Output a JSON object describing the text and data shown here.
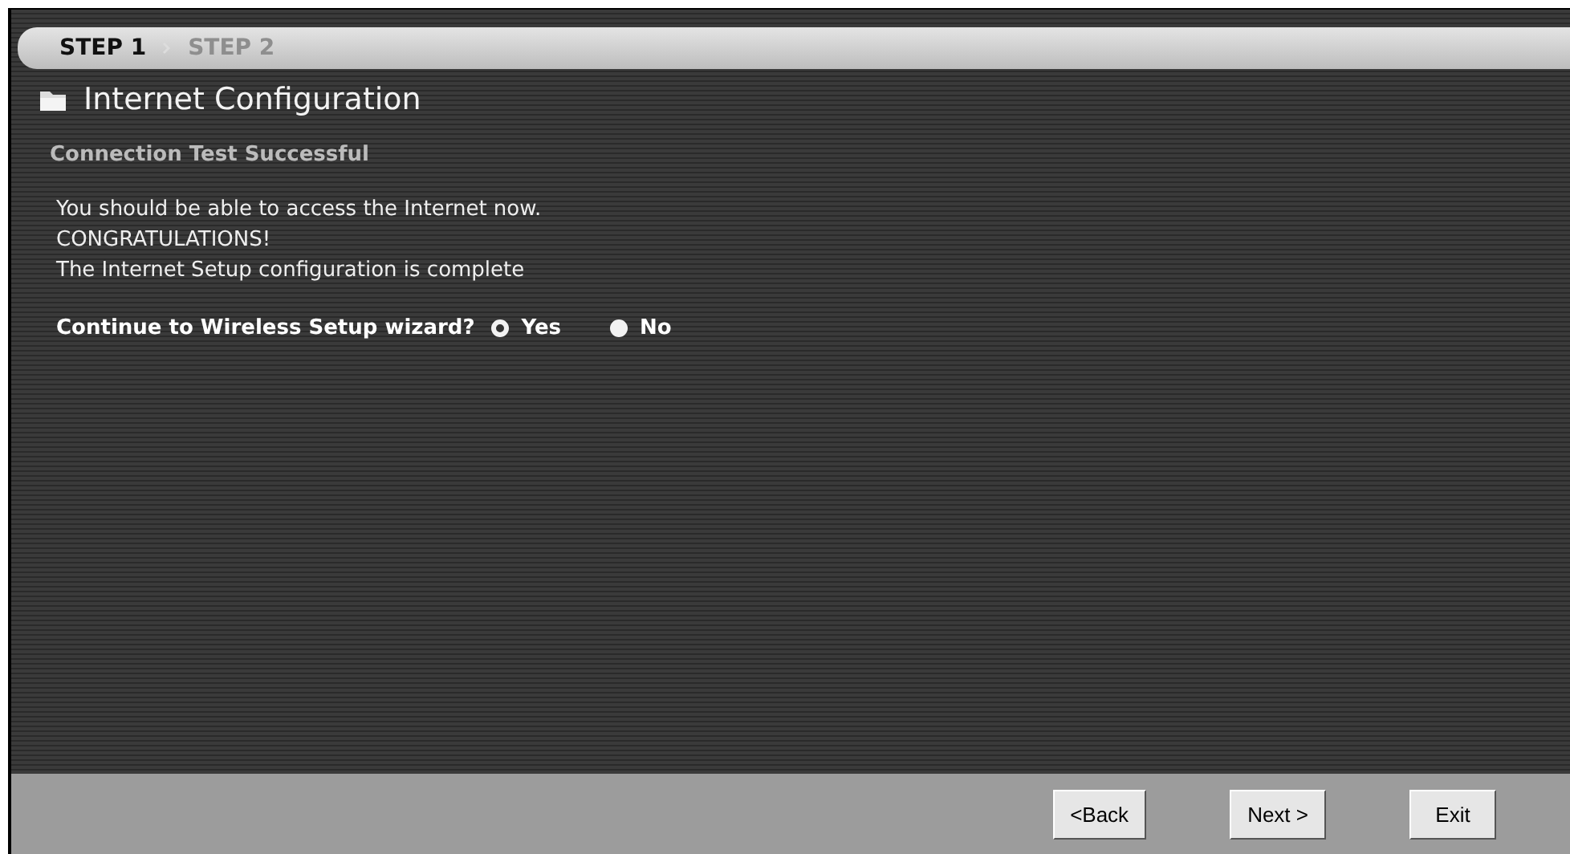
{
  "steps": [
    {
      "label": "STEP 1",
      "selected": true
    },
    {
      "label": "STEP 2",
      "selected": false
    }
  ],
  "title": "Internet Configuration",
  "section_heading": "Connection Test Successful",
  "messages": [
    "You should be able to access the Internet now.",
    "CONGRATULATIONS!",
    "The Internet Setup configuration is complete"
  ],
  "question": {
    "label": "Continue to Wireless Setup wizard?",
    "options": [
      {
        "label": "Yes",
        "selected": true
      },
      {
        "label": "No",
        "selected": false
      }
    ]
  },
  "buttons": [
    "<Back",
    "Next >",
    "Exit"
  ]
}
